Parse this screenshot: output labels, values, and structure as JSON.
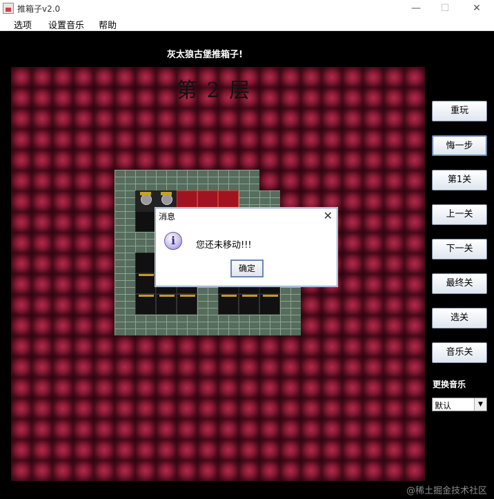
{
  "window": {
    "title": "推箱子v2.0",
    "controls": {
      "minimize": "—",
      "maximize": "☐",
      "close": "✕"
    }
  },
  "menu": [
    "选项",
    "设置音乐",
    "帮助"
  ],
  "game": {
    "banner": "灰太狼古堡推箱子!",
    "level_header": "第  2  层"
  },
  "sidebar": {
    "buttons": [
      "重玩",
      "悔一步",
      "第1关",
      "上一关",
      "下一关",
      "最终关",
      "选关",
      "音乐关"
    ],
    "music_label": "更换音乐",
    "music_value": "默认"
  },
  "dialog": {
    "title": "消息",
    "icon": "info-icon",
    "message": "您还未移动!!!",
    "ok_label": "确定"
  },
  "watermark": "@稀土掘金技术社区",
  "colors": {
    "tile_red": "#8a1a36",
    "wall": "#566c5c",
    "target": "#a01420"
  },
  "board": {
    "rows": [
      "WWWWWWW..",
      "WPPTTTWW.",
      "WFFFFFFW.",
      "WWFFFFFFW",
      "WFFFFFFFW",
      "WBFBWFFFW",
      "WBBBWBBBW",
      "WWWWWWWWW"
    ],
    "legend": {
      "W": "wall",
      "F": "floor",
      "T": "target",
      "B": "box",
      "P": "player",
      ".": "empty"
    }
  }
}
